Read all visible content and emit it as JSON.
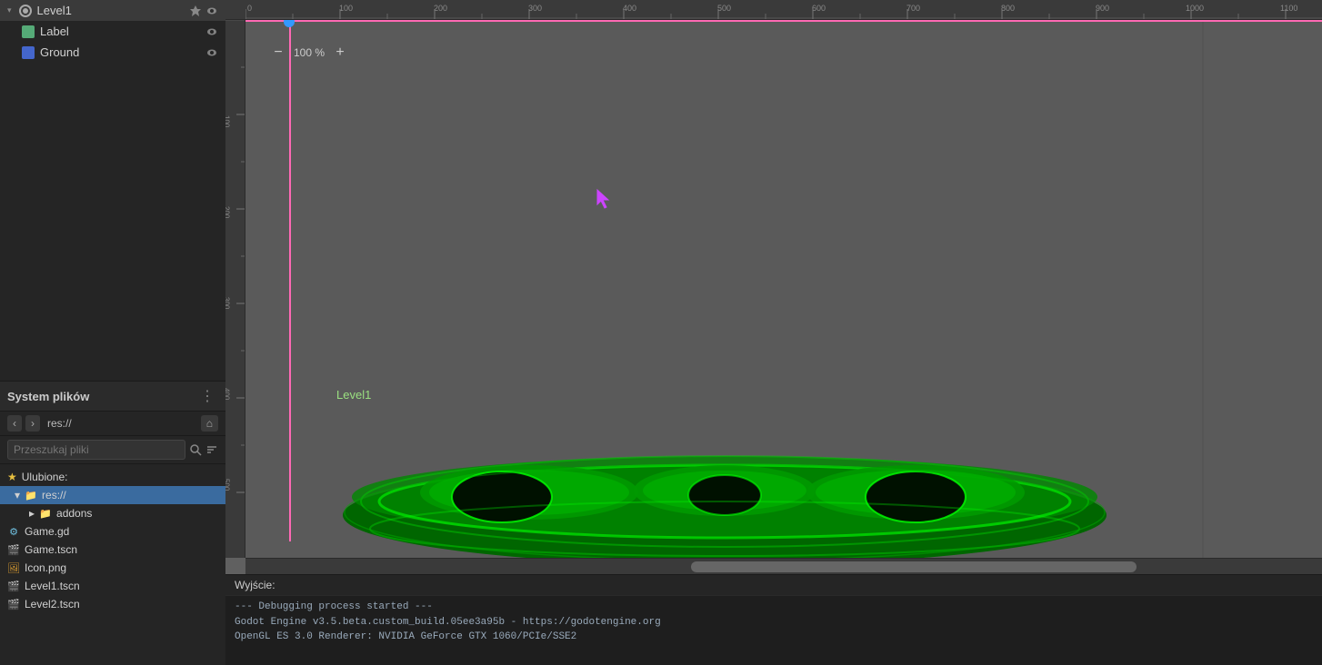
{
  "sceneTree": {
    "items": [
      {
        "id": "level1",
        "label": "Level1",
        "icon": "level",
        "indent": 0,
        "hasPin": true,
        "hasEye": true,
        "expanded": true
      },
      {
        "id": "label",
        "label": "Label",
        "icon": "label",
        "indent": 1,
        "hasPin": false,
        "hasEye": true
      },
      {
        "id": "ground",
        "label": "Ground",
        "icon": "ground",
        "indent": 1,
        "hasPin": false,
        "hasEye": true
      }
    ]
  },
  "filesystem": {
    "title": "System plików",
    "path": "res://",
    "searchPlaceholder": "Przeszukaj pliki",
    "favorites": {
      "label": "Ulubione:"
    },
    "items": [
      {
        "id": "res",
        "label": "res://",
        "type": "folder-selected",
        "indent": 0
      },
      {
        "id": "addons",
        "label": "addons",
        "type": "folder",
        "indent": 1
      },
      {
        "id": "game-gd",
        "label": "Game.gd",
        "type": "script",
        "indent": 0
      },
      {
        "id": "game-tscn",
        "label": "Game.tscn",
        "type": "scene",
        "indent": 0
      },
      {
        "id": "icon-png",
        "label": "Icon.png",
        "type": "image",
        "indent": 0
      },
      {
        "id": "level1-tscn",
        "label": "Level1.tscn",
        "type": "scene",
        "indent": 0
      },
      {
        "id": "level2-tscn",
        "label": "Level2.tscn",
        "type": "scene",
        "indent": 0
      }
    ]
  },
  "viewport": {
    "zoom": "100 %",
    "levelLabel": "Level1",
    "rulerMarks": [
      0,
      100,
      200,
      300,
      400,
      500,
      600,
      700,
      800,
      900,
      1000,
      1100
    ],
    "vRulerMarks": [
      100,
      200,
      300,
      400,
      500
    ]
  },
  "output": {
    "title": "Wyjście:",
    "lines": [
      "--- Debugging process started ---",
      "Godot Engine v3.5.beta.custom_build.05ee3a95b - https://godotengine.org",
      "OpenGL ES 3.0 Renderer: NVIDIA GeForce GTX 1060/PCIe/SSE2"
    ]
  },
  "colors": {
    "accent": "#ff69b4",
    "ground": "#00cc00",
    "levelLabel": "#9ae080",
    "cursorPurple": "#cc44ff"
  }
}
